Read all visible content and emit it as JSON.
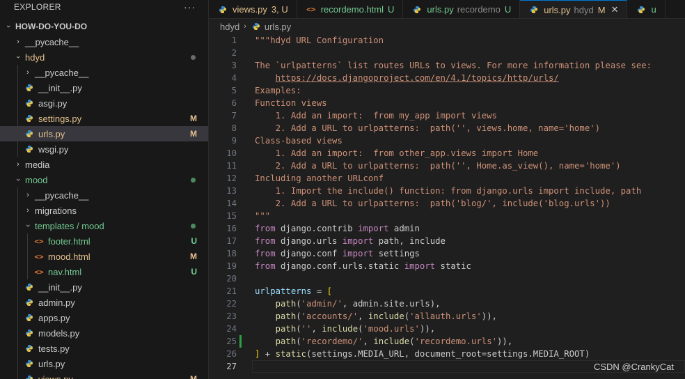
{
  "explorer": {
    "title": "EXPLORER",
    "more": "···",
    "root": "HOW-DO-YOU-DO",
    "items": [
      {
        "label": "__pycache__",
        "depth": 1,
        "kind": "folder",
        "open": false,
        "color": "#cccccc",
        "status": "",
        "dot": ""
      },
      {
        "label": "hdyd",
        "depth": 1,
        "kind": "folder",
        "open": true,
        "color": "#e2c08d",
        "status": "",
        "dot": "#6b6b6b"
      },
      {
        "label": "__pycache__",
        "depth": 2,
        "kind": "folder",
        "open": false,
        "color": "#cccccc",
        "status": "",
        "dot": ""
      },
      {
        "label": "__init__.py",
        "depth": 2,
        "kind": "py",
        "color": "#cccccc",
        "status": "",
        "dot": ""
      },
      {
        "label": "asgi.py",
        "depth": 2,
        "kind": "py",
        "color": "#cccccc",
        "status": "",
        "dot": ""
      },
      {
        "label": "settings.py",
        "depth": 2,
        "kind": "py",
        "color": "#e2c08d",
        "status": "M",
        "dot": ""
      },
      {
        "label": "urls.py",
        "depth": 2,
        "kind": "py",
        "color": "#e2c08d",
        "status": "M",
        "dot": "",
        "selected": true
      },
      {
        "label": "wsgi.py",
        "depth": 2,
        "kind": "py",
        "color": "#cccccc",
        "status": "",
        "dot": ""
      },
      {
        "label": "media",
        "depth": 1,
        "kind": "folder",
        "open": false,
        "color": "#cccccc",
        "status": "",
        "dot": ""
      },
      {
        "label": "mood",
        "depth": 1,
        "kind": "folder",
        "open": true,
        "color": "#73c991",
        "status": "",
        "dot": "#4a8a5c"
      },
      {
        "label": "__pycache__",
        "depth": 2,
        "kind": "folder",
        "open": false,
        "color": "#cccccc",
        "status": "",
        "dot": ""
      },
      {
        "label": "migrations",
        "depth": 2,
        "kind": "folder",
        "open": false,
        "color": "#cccccc",
        "status": "",
        "dot": ""
      },
      {
        "label": "templates / mood",
        "depth": 2,
        "kind": "folder",
        "open": true,
        "color": "#73c991",
        "status": "",
        "dot": "#4a8a5c"
      },
      {
        "label": "footer.html",
        "depth": 3,
        "kind": "html",
        "color": "#73c991",
        "status": "U",
        "dot": ""
      },
      {
        "label": "mood.html",
        "depth": 3,
        "kind": "html",
        "color": "#e2c08d",
        "status": "M",
        "dot": ""
      },
      {
        "label": "nav.html",
        "depth": 3,
        "kind": "html",
        "color": "#73c991",
        "status": "U",
        "dot": ""
      },
      {
        "label": "__init__.py",
        "depth": 2,
        "kind": "py",
        "color": "#cccccc",
        "status": "",
        "dot": ""
      },
      {
        "label": "admin.py",
        "depth": 2,
        "kind": "py",
        "color": "#cccccc",
        "status": "",
        "dot": ""
      },
      {
        "label": "apps.py",
        "depth": 2,
        "kind": "py",
        "color": "#cccccc",
        "status": "",
        "dot": ""
      },
      {
        "label": "models.py",
        "depth": 2,
        "kind": "py",
        "color": "#cccccc",
        "status": "",
        "dot": ""
      },
      {
        "label": "tests.py",
        "depth": 2,
        "kind": "py",
        "color": "#cccccc",
        "status": "",
        "dot": ""
      },
      {
        "label": "urls.py",
        "depth": 2,
        "kind": "py",
        "color": "#cccccc",
        "status": "",
        "dot": ""
      },
      {
        "label": "views.py",
        "depth": 2,
        "kind": "py",
        "color": "#e2c08d",
        "status": "M",
        "dot": ""
      }
    ]
  },
  "tabs": [
    {
      "label": "views.py",
      "sub": "",
      "state": "3, U",
      "state_color": "#e2c08d",
      "label_color": "#e2c08d",
      "icon": "python-icon",
      "active": false,
      "close": ""
    },
    {
      "label": "recordemo.html",
      "sub": "",
      "state": "U",
      "state_color": "#73c991",
      "label_color": "#73c991",
      "icon": "html-icon",
      "active": false,
      "close": ""
    },
    {
      "label": "urls.py",
      "sub": "recordemo",
      "state": "U",
      "state_color": "#73c991",
      "label_color": "#73c991",
      "icon": "python-icon",
      "active": false,
      "close": ""
    },
    {
      "label": "urls.py",
      "sub": "hdyd",
      "state": "M",
      "state_color": "#e2c08d",
      "label_color": "#e2c08d",
      "icon": "python-icon",
      "active": true,
      "close": "✕"
    },
    {
      "label": "u",
      "sub": "",
      "state": "",
      "state_color": "#73c991",
      "label_color": "#73c991",
      "icon": "python-icon",
      "active": false,
      "close": ""
    }
  ],
  "breadcrumb": {
    "folder": "hdyd",
    "sep": "›",
    "file": "urls.py"
  },
  "editor": {
    "lines": [
      {
        "n": "1",
        "tokens": [
          [
            "\"\"\"hdyd URL Configuration",
            "str"
          ]
        ]
      },
      {
        "n": "2",
        "tokens": []
      },
      {
        "n": "3",
        "tokens": [
          [
            "The `urlpatterns` list routes URLs to views. For more information please see:",
            "str"
          ]
        ]
      },
      {
        "n": "4",
        "tokens": [
          [
            "    ",
            "str"
          ],
          [
            "https://docs.djangoproject.com/en/4.1/topics/http/urls/",
            "link"
          ]
        ]
      },
      {
        "n": "5",
        "tokens": [
          [
            "Examples:",
            "str"
          ]
        ]
      },
      {
        "n": "6",
        "tokens": [
          [
            "Function views",
            "str"
          ]
        ]
      },
      {
        "n": "7",
        "tokens": [
          [
            "    1. Add an import:  from my_app import views",
            "str"
          ]
        ]
      },
      {
        "n": "8",
        "tokens": [
          [
            "    2. Add a URL to urlpatterns:  path('', views.home, name='home')",
            "str"
          ]
        ]
      },
      {
        "n": "9",
        "tokens": [
          [
            "Class-based views",
            "str"
          ]
        ]
      },
      {
        "n": "10",
        "tokens": [
          [
            "    1. Add an import:  from other_app.views import Home",
            "str"
          ]
        ]
      },
      {
        "n": "11",
        "tokens": [
          [
            "    2. Add a URL to urlpatterns:  path('', Home.as_view(), name='home')",
            "str"
          ]
        ]
      },
      {
        "n": "12",
        "tokens": [
          [
            "Including another URLconf",
            "str"
          ]
        ]
      },
      {
        "n": "13",
        "tokens": [
          [
            "    1. Import the include() function: from django.urls import include, path",
            "str"
          ]
        ]
      },
      {
        "n": "14",
        "tokens": [
          [
            "    2. Add a URL to urlpatterns:  path('blog/', include('blog.urls'))",
            "str"
          ]
        ]
      },
      {
        "n": "15",
        "tokens": [
          [
            "\"\"\"",
            "str"
          ]
        ]
      },
      {
        "n": "16",
        "tokens": [
          [
            "from",
            "ctrl"
          ],
          [
            " django.contrib ",
            "plain"
          ],
          [
            "import",
            "ctrl"
          ],
          [
            " admin",
            "plain"
          ]
        ]
      },
      {
        "n": "17",
        "tokens": [
          [
            "from",
            "ctrl"
          ],
          [
            " django.urls ",
            "plain"
          ],
          [
            "import",
            "ctrl"
          ],
          [
            " path, include",
            "plain"
          ]
        ]
      },
      {
        "n": "18",
        "tokens": [
          [
            "from",
            "ctrl"
          ],
          [
            " django.conf ",
            "plain"
          ],
          [
            "import",
            "ctrl"
          ],
          [
            " settings",
            "plain"
          ]
        ]
      },
      {
        "n": "19",
        "tokens": [
          [
            "from",
            "ctrl"
          ],
          [
            " django.conf.urls.static ",
            "plain"
          ],
          [
            "import",
            "ctrl"
          ],
          [
            " static",
            "plain"
          ]
        ]
      },
      {
        "n": "20",
        "tokens": []
      },
      {
        "n": "21",
        "tokens": [
          [
            "urlpatterns",
            "var"
          ],
          [
            " = ",
            "plain"
          ],
          [
            "[",
            "br"
          ]
        ]
      },
      {
        "n": "22",
        "tokens": [
          [
            "    ",
            "plain"
          ],
          [
            "path",
            "fn"
          ],
          [
            "(",
            "plain"
          ],
          [
            "'admin/'",
            "str"
          ],
          [
            ", admin.site.urls),",
            "plain"
          ]
        ]
      },
      {
        "n": "23",
        "tokens": [
          [
            "    ",
            "plain"
          ],
          [
            "path",
            "fn"
          ],
          [
            "(",
            "plain"
          ],
          [
            "'accounts/'",
            "str"
          ],
          [
            ", ",
            "plain"
          ],
          [
            "include",
            "fn"
          ],
          [
            "(",
            "plain"
          ],
          [
            "'allauth.urls'",
            "str"
          ],
          [
            ")),",
            "plain"
          ]
        ]
      },
      {
        "n": "24",
        "tokens": [
          [
            "    ",
            "plain"
          ],
          [
            "path",
            "fn"
          ],
          [
            "(",
            "plain"
          ],
          [
            "''",
            "str"
          ],
          [
            ", ",
            "plain"
          ],
          [
            "include",
            "fn"
          ],
          [
            "(",
            "plain"
          ],
          [
            "'mood.urls'",
            "str"
          ],
          [
            ")),",
            "plain"
          ]
        ]
      },
      {
        "n": "25",
        "tokens": [
          [
            "    ",
            "plain"
          ],
          [
            "path",
            "fn"
          ],
          [
            "(",
            "plain"
          ],
          [
            "'recordemo/'",
            "str"
          ],
          [
            ", ",
            "plain"
          ],
          [
            "include",
            "fn"
          ],
          [
            "(",
            "plain"
          ],
          [
            "'recordemo.urls'",
            "str"
          ],
          [
            ")),",
            "plain"
          ]
        ],
        "mark": true
      },
      {
        "n": "26",
        "tokens": [
          [
            "]",
            "br"
          ],
          [
            " + ",
            "plain"
          ],
          [
            "static",
            "fn"
          ],
          [
            "(settings.MEDIA_URL, document_root=settings.MEDIA_ROOT)",
            "plain"
          ]
        ]
      },
      {
        "n": "27",
        "tokens": [],
        "current": true
      }
    ]
  },
  "watermark": "CSDN @CrankyCat",
  "colors": {
    "python_icon": "#3b8ed0",
    "html_icon": "#e37933",
    "modified": "#e2c08d",
    "untracked": "#73c991"
  }
}
